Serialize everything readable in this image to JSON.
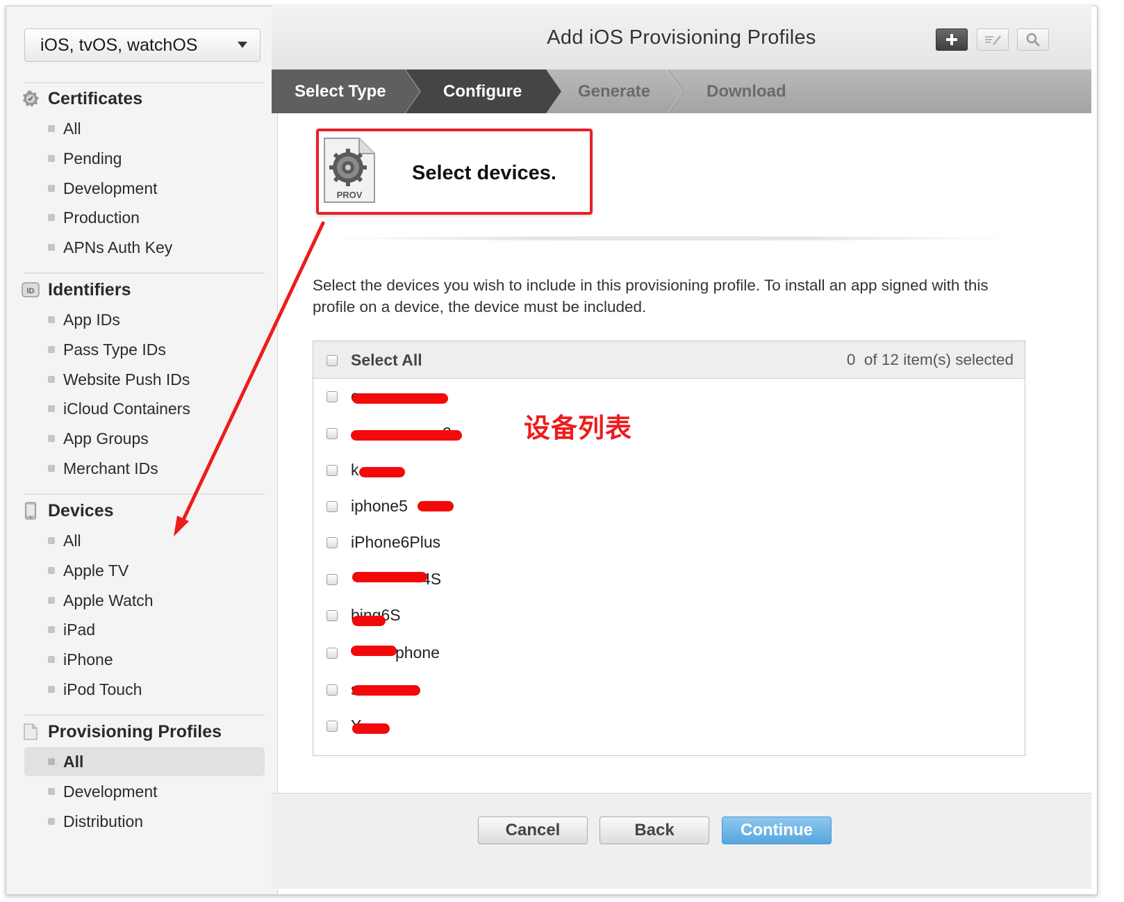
{
  "platform_select": {
    "value": "iOS, tvOS, watchOS"
  },
  "sidebar": {
    "sections": [
      {
        "title": "Certificates",
        "icon": "certificate-badge-icon",
        "items": [
          "All",
          "Pending",
          "Development",
          "Production",
          "APNs Auth Key"
        ]
      },
      {
        "title": "Identifiers",
        "icon": "id-badge-icon",
        "items": [
          "App IDs",
          "Pass Type IDs",
          "Website Push IDs",
          "iCloud Containers",
          "App Groups",
          "Merchant IDs"
        ]
      },
      {
        "title": "Devices",
        "icon": "device-phone-icon",
        "items": [
          "All",
          "Apple TV",
          "Apple Watch",
          "iPad",
          "iPhone",
          "iPod Touch"
        ]
      },
      {
        "title": "Provisioning Profiles",
        "icon": "document-icon",
        "items": [
          "All",
          "Development",
          "Distribution"
        ],
        "active_item": "All"
      }
    ]
  },
  "header": {
    "title": "Add iOS Provisioning Profiles",
    "tools": [
      "add-icon",
      "edit-icon",
      "search-icon"
    ]
  },
  "steps": {
    "labels": [
      "Select Type",
      "Configure",
      "Generate",
      "Download"
    ],
    "current": "Configure"
  },
  "callout": {
    "title": "Select devices.",
    "file_badge": "PROV"
  },
  "instructions": "Select the devices you wish to include in this provisioning profile. To install an app signed with this profile on a device, the device must be included.",
  "device_table": {
    "select_all_label": "Select All",
    "selected_count": "0",
    "count_text": "of 12 item(s) selected",
    "devices": [
      {
        "name": "c",
        "redacted": true
      },
      {
        "name": "2",
        "redacted": true
      },
      {
        "name": "k",
        "redacted": true
      },
      {
        "name": "iphone5",
        "redacted": true
      },
      {
        "name": "iPhone6Plus",
        "redacted": false
      },
      {
        "name": "4S",
        "redacted": true
      },
      {
        "name": "bing6S",
        "redacted": true
      },
      {
        "name": "phone",
        "redacted": true
      },
      {
        "name": "s",
        "redacted": true
      },
      {
        "name": "Y",
        "redacted": true
      }
    ]
  },
  "annotation": "设备列表",
  "footer": {
    "cancel": "Cancel",
    "back": "Back",
    "continue": "Continue"
  },
  "colors": {
    "annotation_red": "#e8202a",
    "continue_blue": "#56a6dc"
  }
}
